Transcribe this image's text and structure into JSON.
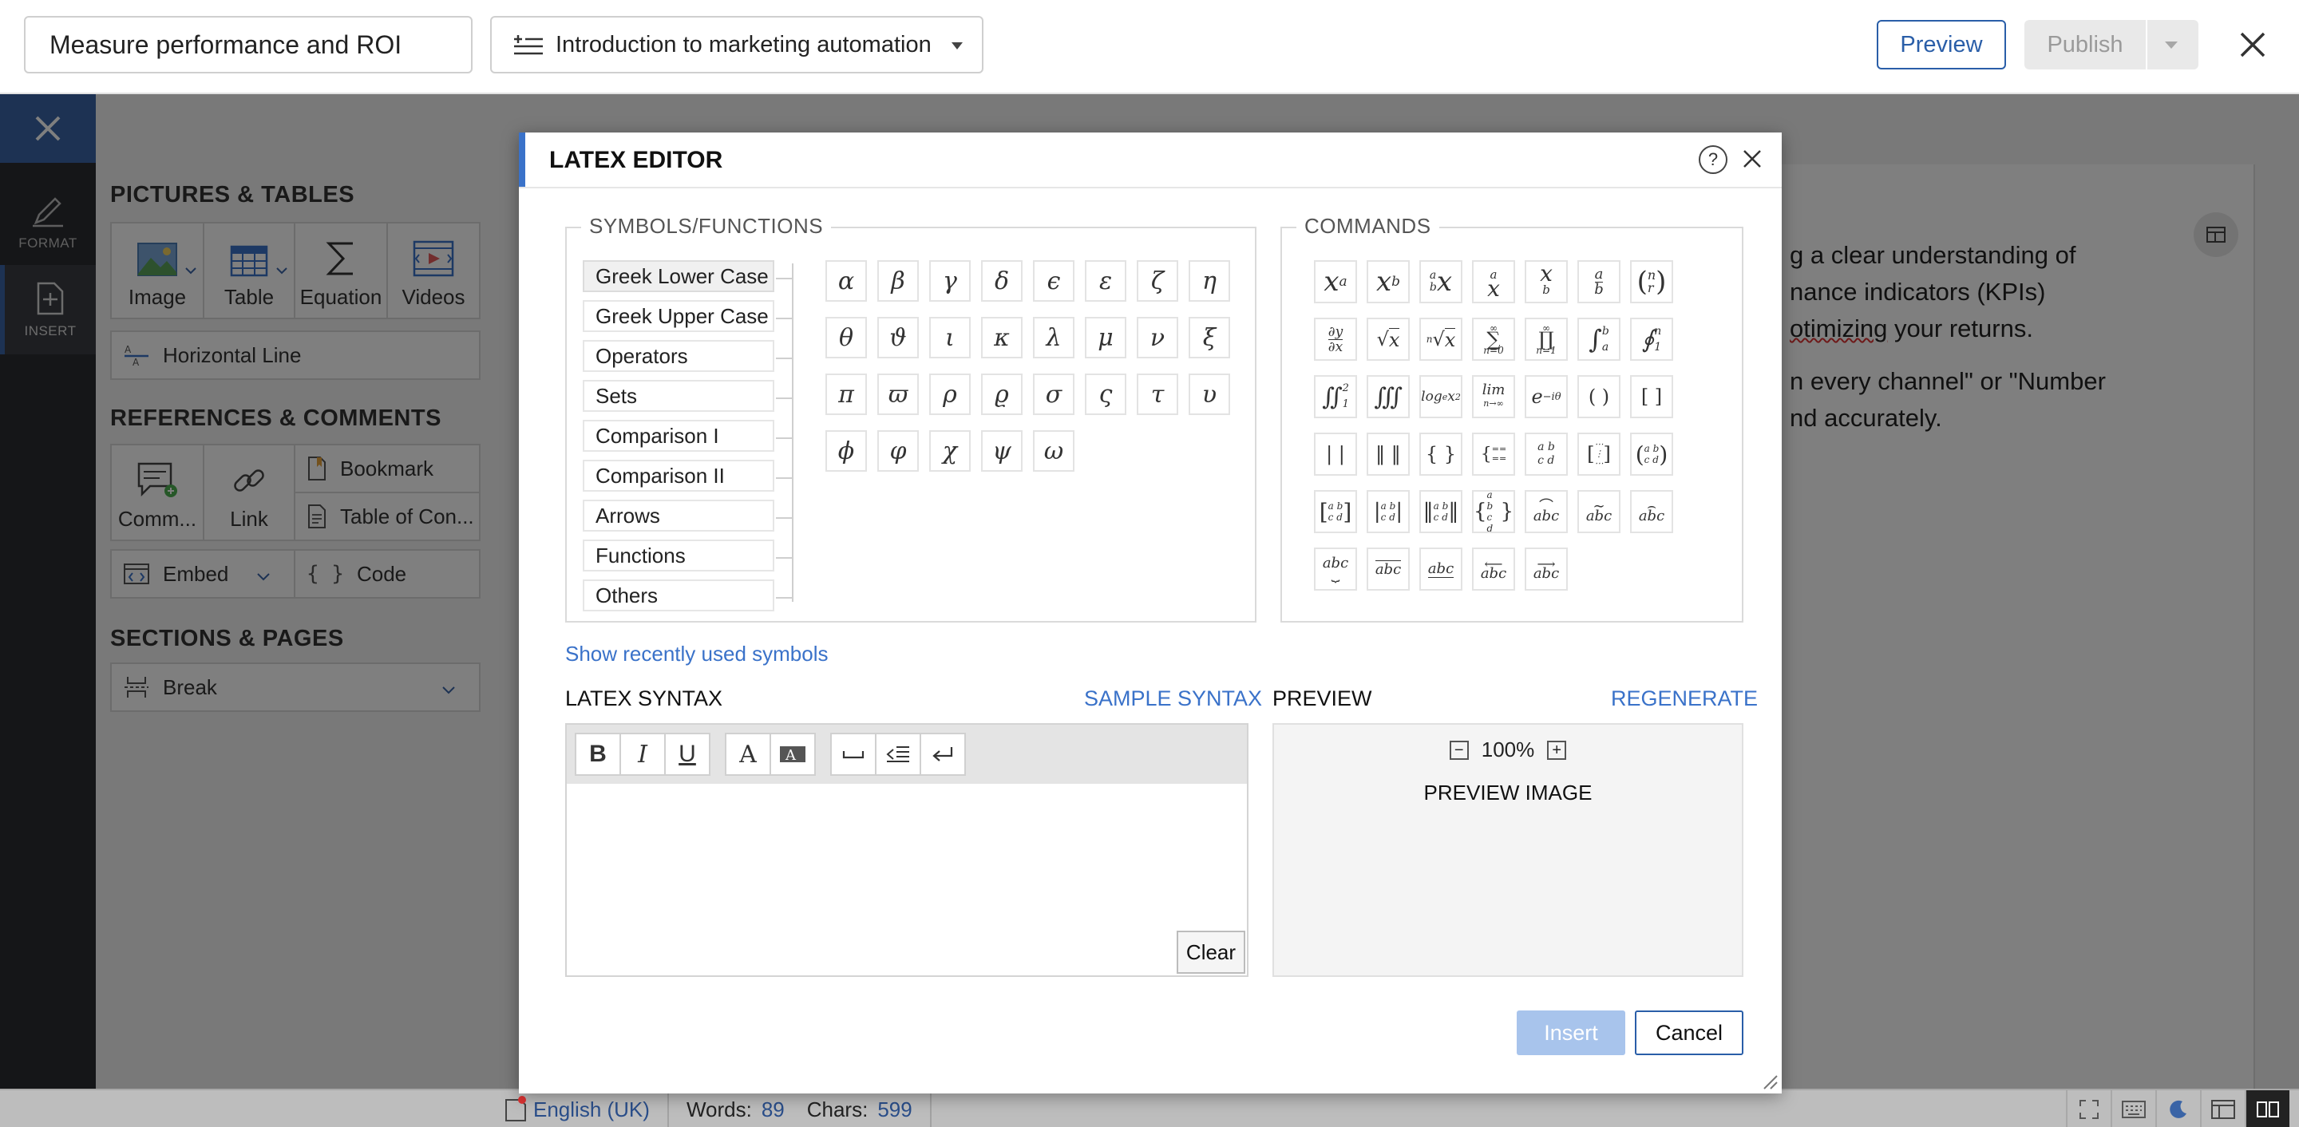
{
  "topbar": {
    "lesson_title": "Measure performance and ROI",
    "course_name": "Introduction to marketing automation",
    "preview_label": "Preview",
    "publish_label": "Publish"
  },
  "rail": {
    "format_label": "FORMAT",
    "insert_label": "INSERT"
  },
  "panel": {
    "pictures_heading": "PICTURES & TABLES",
    "image_label": "Image",
    "table_label": "Table",
    "equation_label": "Equation",
    "videos_label": "Videos",
    "hline_label": "Horizontal Line",
    "references_heading": "REFERENCES & COMMENTS",
    "comments_label": "Comm...",
    "link_label": "Link",
    "bookmark_label": "Bookmark",
    "toc_label": "Table of Con...",
    "embed_label": "Embed",
    "code_label": "Code",
    "sections_heading": "SECTIONS & PAGES",
    "break_label": "Break"
  },
  "document": {
    "lines": [
      "g a clear understanding of",
      "nance indicators (KPIs)",
      "otimizing your returns.",
      "n every channel\" or \"Number",
      "nd accurately."
    ],
    "misspelled_word": "otimizing"
  },
  "dialog": {
    "title": "LATEX EDITOR",
    "help_glyph": "?",
    "symbols_legend": "SYMBOLS/FUNCTIONS",
    "commands_legend": "COMMANDS",
    "categories": [
      "Greek Lower Case",
      "Greek Upper Case",
      "Operators",
      "Sets",
      "Comparison I",
      "Comparison II",
      "Arrows",
      "Functions",
      "Others"
    ],
    "active_category": "Greek Lower Case",
    "symbols": [
      "α",
      "β",
      "γ",
      "δ",
      "ϵ",
      "ε",
      "ζ",
      "η",
      "θ",
      "ϑ",
      "ι",
      "κ",
      "λ",
      "μ",
      "ν",
      "ξ",
      "π",
      "ϖ",
      "ρ",
      "ϱ",
      "σ",
      "ς",
      "τ",
      "υ",
      "ϕ",
      "φ",
      "χ",
      "ψ",
      "ω"
    ],
    "recent_link": "Show recently used symbols",
    "syntax_label": "LATEX SYNTAX",
    "sample_link": "SAMPLE SYNTAX",
    "preview_label": "PREVIEW",
    "regenerate_link": "REGENERATE",
    "toolbar": {
      "bold": "B",
      "italic": "I",
      "underline": "U",
      "font_color": "A"
    },
    "clear_label": "Clear",
    "zoom_value": "100%",
    "preview_image_text": "PREVIEW IMAGE",
    "insert_label": "Insert",
    "cancel_label": "Cancel"
  },
  "statusbar": {
    "language": "English (UK)",
    "words_label": "Words:",
    "words_value": "89",
    "chars_label": "Chars:",
    "chars_value": "599"
  },
  "colors": {
    "accent_blue": "#3a72c9",
    "rail_bg": "#2b2d31",
    "insert_disabled": "#a8c4ec"
  }
}
